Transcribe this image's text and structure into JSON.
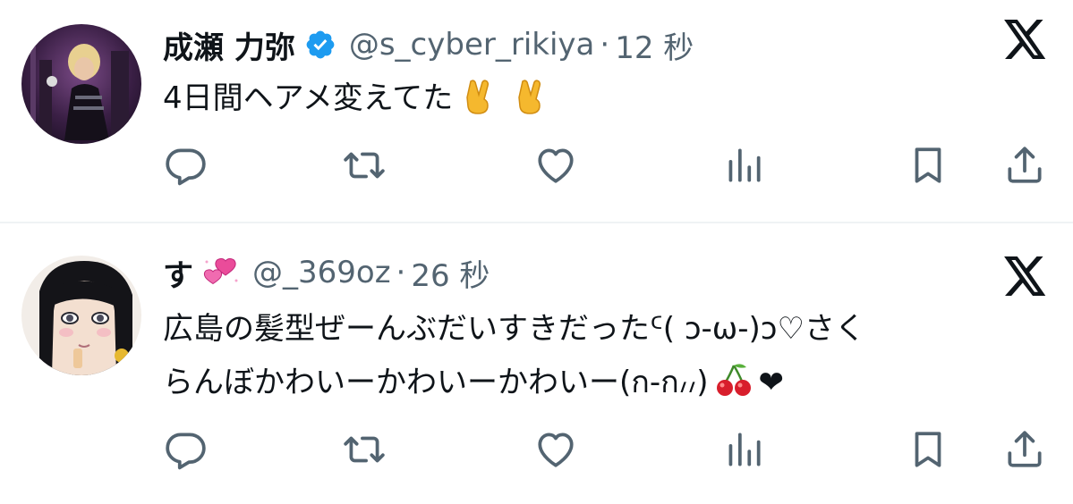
{
  "colors": {
    "text_primary": "#0f1419",
    "text_secondary": "#536471",
    "verified_blue": "#1d9bf0",
    "divider": "#eff3f4",
    "icon": "#536471"
  },
  "tweets": [
    {
      "display_name": "成瀬 力弥",
      "verified": true,
      "handle": "@s_cyber_rikiya",
      "separator": "·",
      "time": "12 秒",
      "text": "4日間ヘアメ変えてた",
      "text_emojis": [
        "victory-hand-emoji",
        "victory-hand-emoji"
      ],
      "avatar": "avatar-rikiya",
      "platform_icon": "x-logo-icon"
    },
    {
      "display_name": "す",
      "name_emoji": "two-hearts-emoji",
      "handle": "@_369oz",
      "separator": "·",
      "time": "26 秒",
      "text_line1": "広島の髪型ぜーんぶだいすきだったᑦ( ɔ-ω-)ɔ♡さく",
      "text_line2_a": "らんぼかわいーかわいーかわいー(ก-ก៸៸)",
      "text_line2_b": "❤",
      "text_emojis": [
        "cherries-emoji"
      ],
      "avatar": "avatar-su",
      "platform_icon": "x-logo-icon"
    }
  ],
  "actions": [
    "reply-icon",
    "retweet-icon",
    "like-icon",
    "views-icon",
    "bookmark-icon",
    "share-icon"
  ]
}
